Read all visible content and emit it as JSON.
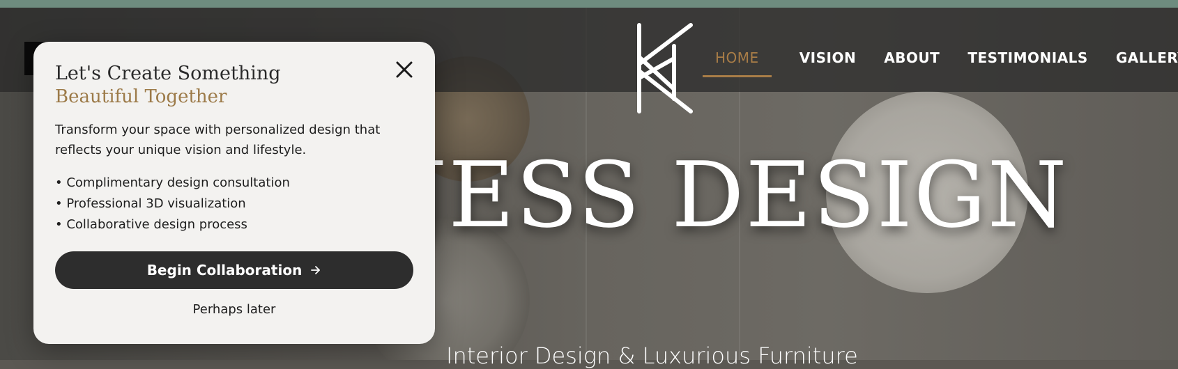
{
  "brand": {
    "title": "KJESS DESIGN",
    "subtitle": "Interior Design & Luxurious Furniture",
    "logo_icon": "kd-monogram-logo",
    "accent_color": "#a97d47"
  },
  "nav": {
    "items": [
      {
        "label": "HOME",
        "active": true
      },
      {
        "label": "VISION",
        "active": false
      },
      {
        "label": "ABOUT",
        "active": false
      },
      {
        "label": "TESTIMONIALS",
        "active": false
      },
      {
        "label": "GALLERY",
        "active": false
      }
    ]
  },
  "modal": {
    "title_line1": "Let's Create Something",
    "title_line2": "Beautiful Together",
    "description": "Transform your space with personalized design that reflects your unique vision and lifestyle.",
    "benefits": [
      "• Complimentary design consultation",
      "• Professional 3D visualization",
      "• Collaborative design process"
    ],
    "cta_label": "Begin Collaboration",
    "cta_icon": "arrow-right-icon",
    "later_label": "Perhaps later",
    "close_icon": "close-icon"
  }
}
